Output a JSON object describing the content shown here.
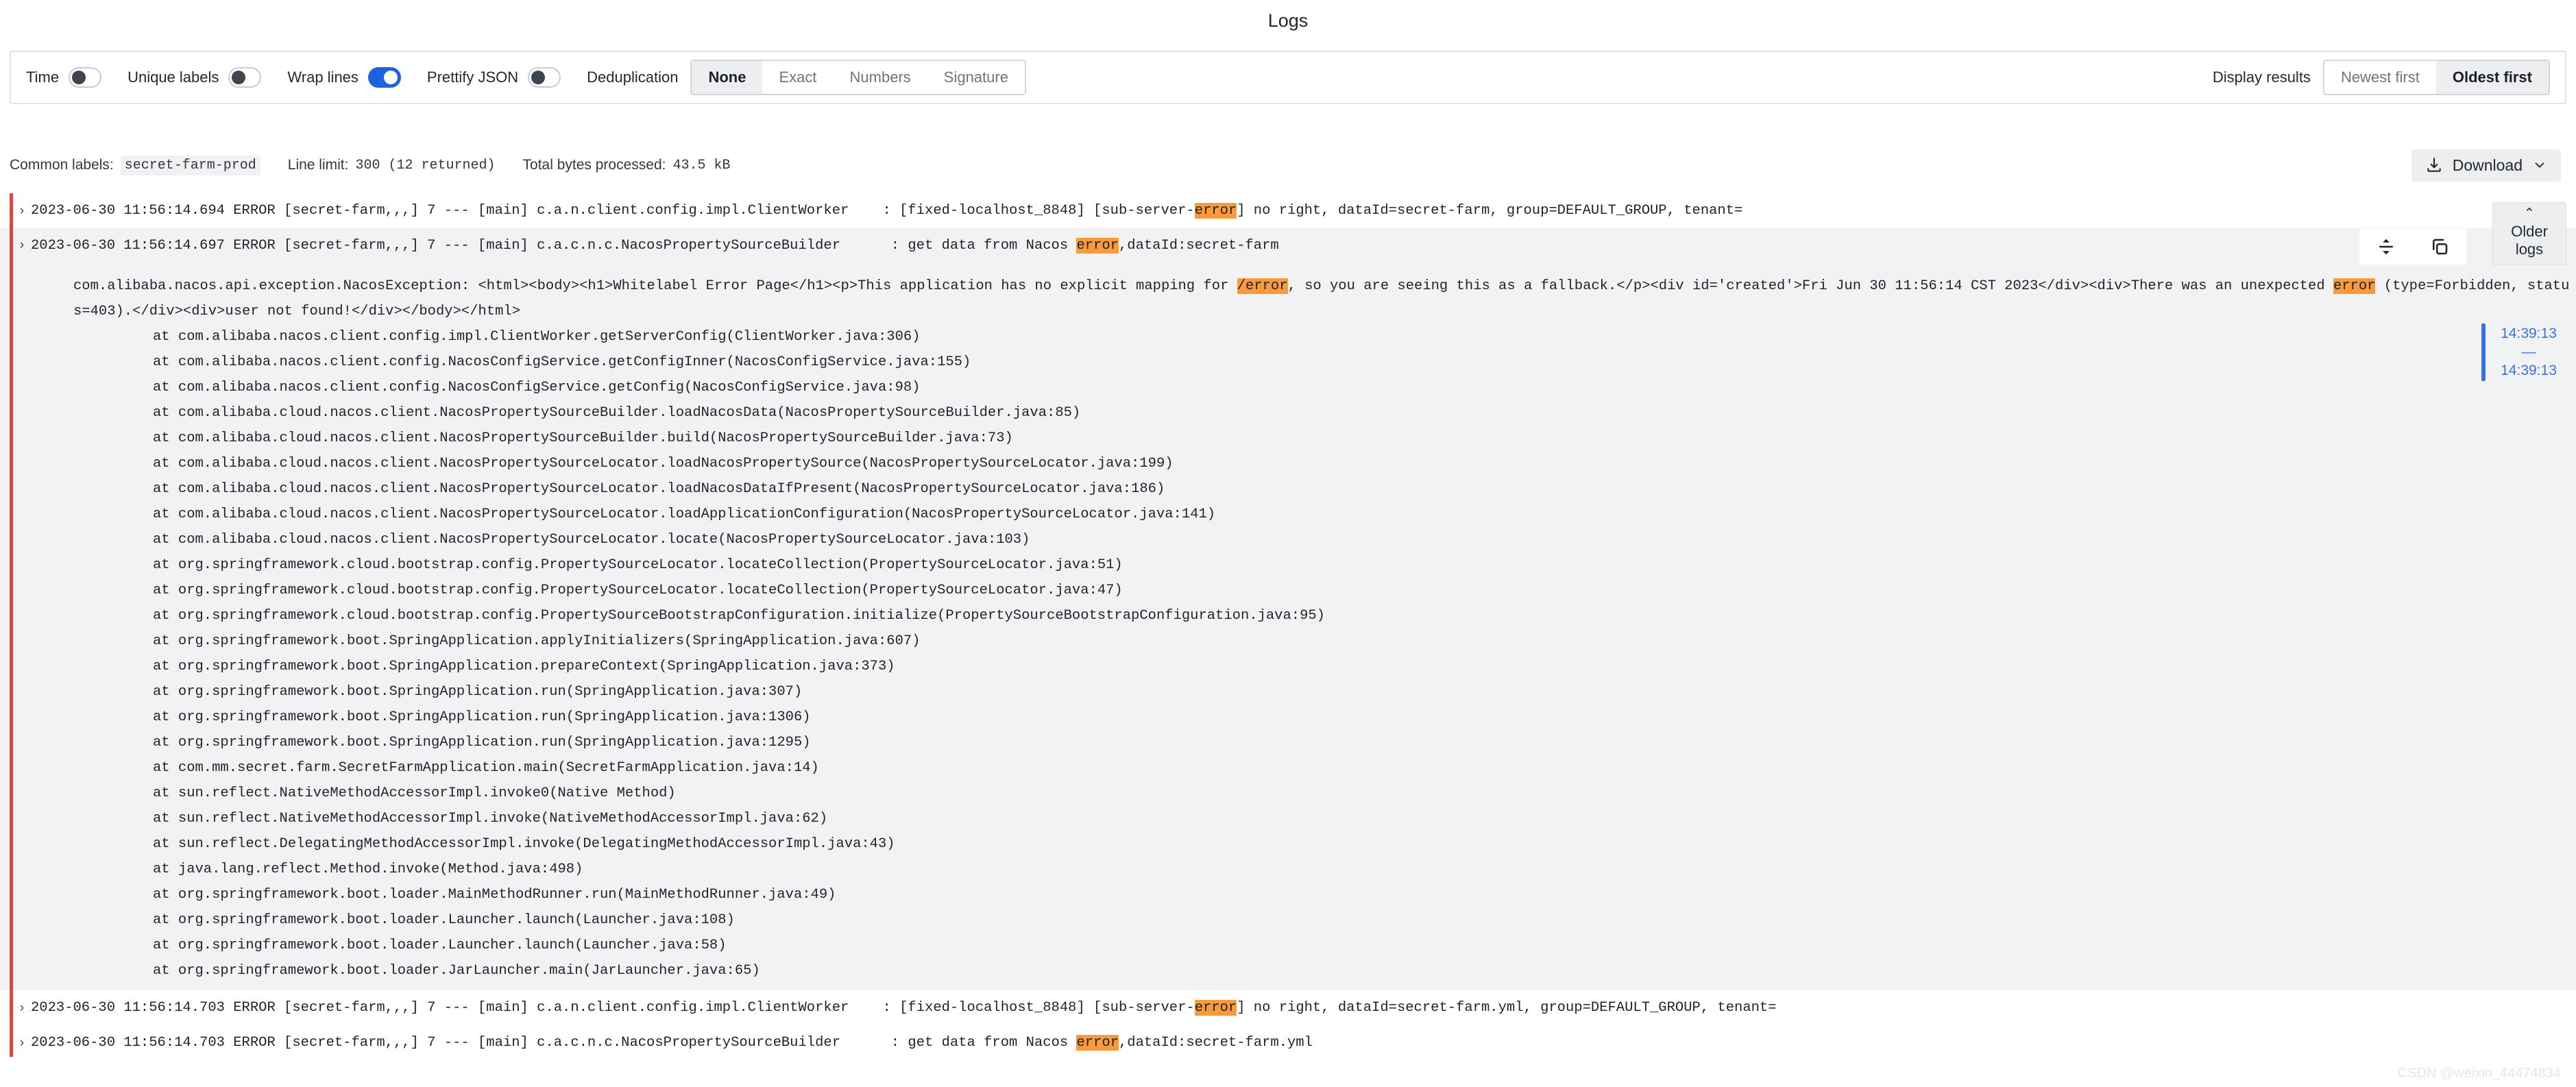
{
  "panel": {
    "title": "Logs"
  },
  "toolbar": {
    "toggles": [
      {
        "label": "Time",
        "on": false,
        "name": "time"
      },
      {
        "label": "Unique labels",
        "on": false,
        "name": "unique-labels"
      },
      {
        "label": "Wrap lines",
        "on": true,
        "name": "wrap-lines"
      },
      {
        "label": "Prettify JSON",
        "on": false,
        "name": "prettify-json"
      }
    ],
    "deduplication": {
      "label": "Deduplication",
      "options": [
        "None",
        "Exact",
        "Numbers",
        "Signature"
      ],
      "selected": "None"
    },
    "display_results": {
      "label": "Display results",
      "options": [
        "Newest first",
        "Oldest first"
      ],
      "selected": "Oldest first"
    }
  },
  "meta": {
    "common_labels_label": "Common labels:",
    "common_labels_value": "secret-farm-prod",
    "line_limit_label": "Line limit:",
    "line_limit_value": "300 (12 returned)",
    "total_bytes_label": "Total bytes processed:",
    "total_bytes_value": "43.5 kB",
    "download_label": "Download",
    "download_caret": "⌄"
  },
  "row_actions": {
    "scroll_title": "scroll-to-line",
    "copy_title": "copy-to-clipboard"
  },
  "older_logs": {
    "caret": "⌃",
    "line1": "Older",
    "line2": "logs"
  },
  "time_marker": {
    "start": "14:39:13",
    "dash": "—",
    "end": "14:39:13"
  },
  "watermark": "CSDN @weixin_44474834",
  "logs": {
    "row1": {
      "chevron": "›",
      "pre": "2023-06-30 11:56:14.694 ERROR [secret-farm,,,] 7 --- [main] c.a.n.client.config.impl.ClientWorker    : [fixed-localhost_8848] [sub-server-",
      "hl": "error",
      "post": "] no right, dataId=secret-farm, group=DEFAULT_GROUP, tenant="
    },
    "row2": {
      "chevron": "›",
      "pre": "2023-06-30 11:56:14.697 ERROR [secret-farm,,,] 7 --- [main] c.a.c.n.c.NacosPropertySourceBuilder      : get data from Nacos ",
      "hl": "error",
      "post": ",dataId:secret-farm",
      "exception": {
        "part1": "com.alibaba.nacos.api.exception.NacosException: <html><body><h1>Whitelabel Error Page</h1><p>This application has no explicit mapping for ",
        "hl1": "/error",
        "part2": ", so you are seeing this as a fallback.</p><div id='created'>Fri Jun 30 11:56:14 CST 2023</div><div>There was an unexpected ",
        "hl2": "error",
        "part3": " (type=Forbidden, status=403).</div><div>user not found!</div></body></html>"
      },
      "stack": [
        "at com.alibaba.nacos.client.config.impl.ClientWorker.getServerConfig(ClientWorker.java:306)",
        "at com.alibaba.nacos.client.config.NacosConfigService.getConfigInner(NacosConfigService.java:155)",
        "at com.alibaba.nacos.client.config.NacosConfigService.getConfig(NacosConfigService.java:98)",
        "at com.alibaba.cloud.nacos.client.NacosPropertySourceBuilder.loadNacosData(NacosPropertySourceBuilder.java:85)",
        "at com.alibaba.cloud.nacos.client.NacosPropertySourceBuilder.build(NacosPropertySourceBuilder.java:73)",
        "at com.alibaba.cloud.nacos.client.NacosPropertySourceLocator.loadNacosPropertySource(NacosPropertySourceLocator.java:199)",
        "at com.alibaba.cloud.nacos.client.NacosPropertySourceLocator.loadNacosDataIfPresent(NacosPropertySourceLocator.java:186)",
        "at com.alibaba.cloud.nacos.client.NacosPropertySourceLocator.loadApplicationConfiguration(NacosPropertySourceLocator.java:141)",
        "at com.alibaba.cloud.nacos.client.NacosPropertySourceLocator.locate(NacosPropertySourceLocator.java:103)",
        "at org.springframework.cloud.bootstrap.config.PropertySourceLocator.locateCollection(PropertySourceLocator.java:51)",
        "at org.springframework.cloud.bootstrap.config.PropertySourceLocator.locateCollection(PropertySourceLocator.java:47)",
        "at org.springframework.cloud.bootstrap.config.PropertySourceBootstrapConfiguration.initialize(PropertySourceBootstrapConfiguration.java:95)",
        "at org.springframework.boot.SpringApplication.applyInitializers(SpringApplication.java:607)",
        "at org.springframework.boot.SpringApplication.prepareContext(SpringApplication.java:373)",
        "at org.springframework.boot.SpringApplication.run(SpringApplication.java:307)",
        "at org.springframework.boot.SpringApplication.run(SpringApplication.java:1306)",
        "at org.springframework.boot.SpringApplication.run(SpringApplication.java:1295)",
        "at com.mm.secret.farm.SecretFarmApplication.main(SecretFarmApplication.java:14)",
        "at sun.reflect.NativeMethodAccessorImpl.invoke0(Native Method)",
        "at sun.reflect.NativeMethodAccessorImpl.invoke(NativeMethodAccessorImpl.java:62)",
        "at sun.reflect.DelegatingMethodAccessorImpl.invoke(DelegatingMethodAccessorImpl.java:43)",
        "at java.lang.reflect.Method.invoke(Method.java:498)",
        "at org.springframework.boot.loader.MainMethodRunner.run(MainMethodRunner.java:49)",
        "at org.springframework.boot.loader.Launcher.launch(Launcher.java:108)",
        "at org.springframework.boot.loader.Launcher.launch(Launcher.java:58)",
        "at org.springframework.boot.loader.JarLauncher.main(JarLauncher.java:65)"
      ]
    },
    "row3": {
      "chevron": "›",
      "pre": "2023-06-30 11:56:14.703 ERROR [secret-farm,,,] 7 --- [main] c.a.n.client.config.impl.ClientWorker    : [fixed-localhost_8848] [sub-server-",
      "hl": "error",
      "post": "] no right, dataId=secret-farm.yml, group=DEFAULT_GROUP, tenant="
    },
    "row4": {
      "chevron": "›",
      "pre": "2023-06-30 11:56:14.703 ERROR [secret-farm,,,] 7 --- [main] c.a.c.n.c.NacosPropertySourceBuilder      : get data from Nacos ",
      "hl": "error",
      "post": ",dataId:secret-farm.yml"
    }
  }
}
